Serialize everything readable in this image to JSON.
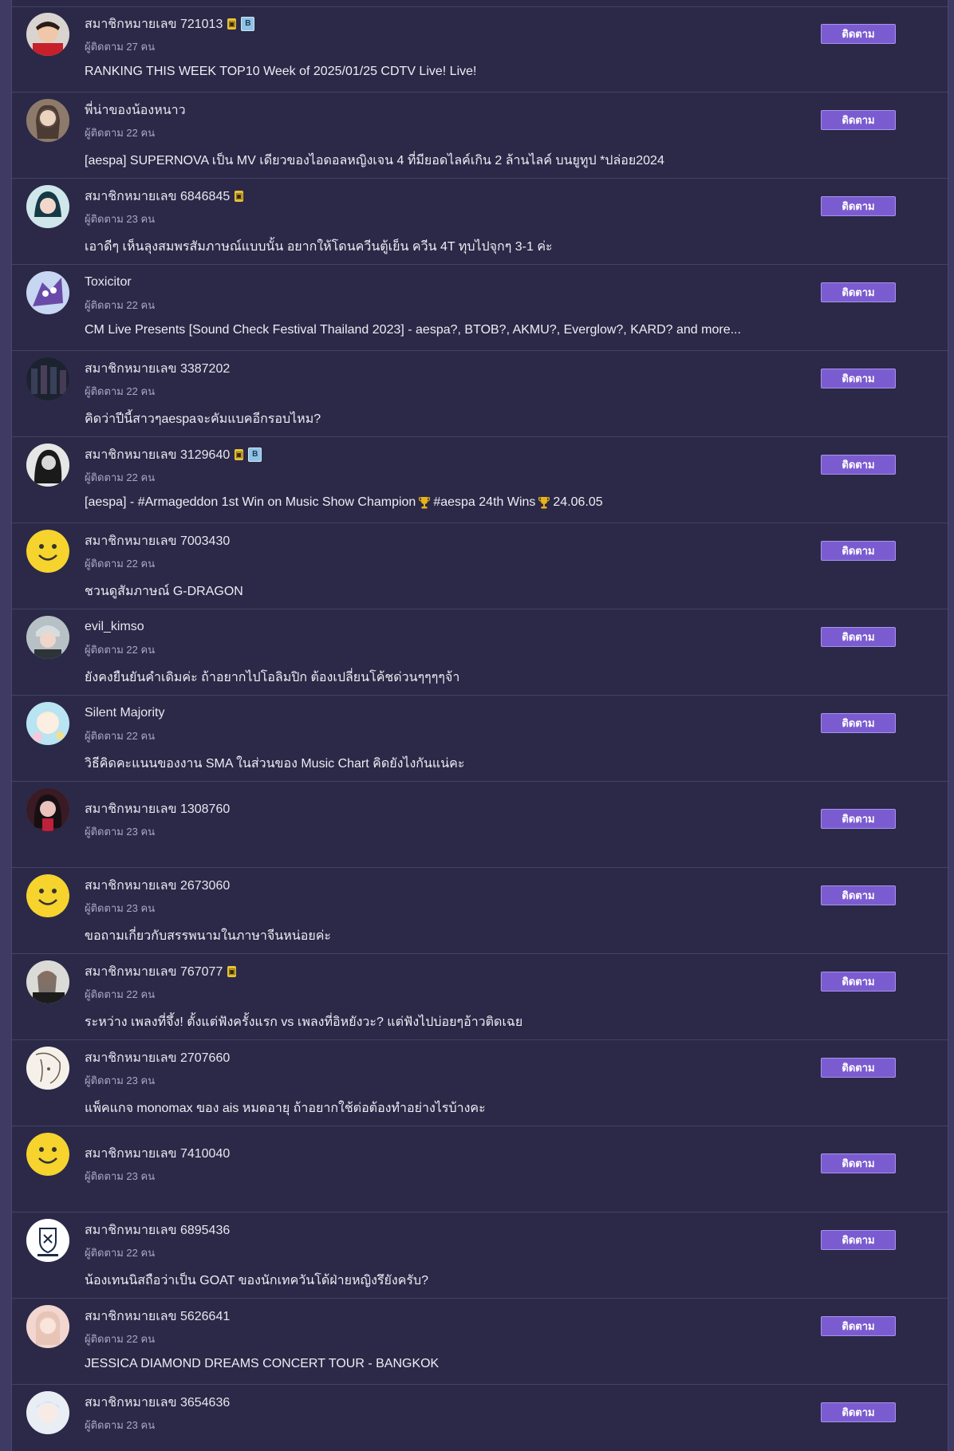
{
  "follow_label": "ติดตาม",
  "colors": {
    "accent": "#7b5cd0",
    "background": "#2b2947",
    "text": "#e6e6f0",
    "muted": "#a9a8c4"
  },
  "rows": [
    {
      "name": "สมาชิกหมายเลข 721013",
      "followers": "ผู้ติดตาม 27 คน",
      "title": "RANKING THIS WEEK TOP10 Week of 2025/01/25 CDTV Live! Live!",
      "badges": [
        "gold",
        "blue"
      ],
      "avatar": "photo-red"
    },
    {
      "name": "พี่น่าของน้องหนาว",
      "followers": "ผู้ติดตาม 22 คน",
      "title": "[aespa] SUPERNOVA เป็น MV เดียวของไอดอลหญิงเจน 4 ที่มียอดไลค์เกิน 2 ล้านไลค์ บนยูทูป *ปล่อย2024",
      "badges": [],
      "avatar": "photo-tan"
    },
    {
      "name": "สมาชิกหมายเลข 6846845",
      "followers": "ผู้ติดตาม 23 คน",
      "title": "เอาดีๆ เห็นลุงสมพรสัมภาษณ์แบบนั้น อยากให้โดนควีนตู้เย็น ควีน 4T ทุบไปจุกๆ 3-1 ค่ะ",
      "badges": [
        "gold"
      ],
      "avatar": "photo-teal"
    },
    {
      "name": "Toxicitor",
      "followers": "ผู้ติดตาม 22 คน",
      "title": "CM Live Presents [Sound Check Festival Thailand 2023] - aespa?, BTOB?, AKMU?, Everglow?, KARD? and more...",
      "badges": [],
      "avatar": "photo-purple"
    },
    {
      "name": "สมาชิกหมายเลข 3387202",
      "followers": "ผู้ติดตาม 22 คน",
      "title": "คิดว่าปีนี้สาวๆaespaจะคัมแบคอีกรอบไหม?",
      "badges": [],
      "avatar": "photo-dark"
    },
    {
      "name": "สมาชิกหมายเลข 3129640",
      "followers": "ผู้ติดตาม 22 คน",
      "title_parts": [
        "[aespa] - #Armageddon 1st Win on Music Show Champion",
        "#aespa 24th Wins",
        "24.06.05"
      ],
      "badges": [
        "gold",
        "blue"
      ],
      "avatar": "photo-bw"
    },
    {
      "name": "สมาชิกหมายเลข 7003430",
      "followers": "ผู้ติดตาม 22 คน",
      "title": "ชวนดูสัมภาษณ์ G-DRAGON",
      "badges": [],
      "avatar": "smiley"
    },
    {
      "name": "evil_kimso",
      "followers": "ผู้ติดตาม 22 คน",
      "title": "ยังคงยืนยันคำเดิมค่ะ ถ้าอยากไปโอลิมปิก ต้องเปลี่ยนโค้ชด่วนๆๆๆๆจ้า",
      "badges": [],
      "avatar": "photo-grey"
    },
    {
      "name": "Silent Majority",
      "followers": "ผู้ติดตาม 22 คน",
      "title": "วิธีคิดคะแนนของงาน SMA ในส่วนของ Music Chart คิดยังไงกันแน่คะ",
      "badges": [],
      "avatar": "photo-anime"
    },
    {
      "name": "สมาชิกหมายเลข 1308760",
      "followers": "ผู้ติดตาม 23 คน",
      "title": "",
      "badges": [],
      "avatar": "photo-crimson"
    },
    {
      "name": "สมาชิกหมายเลข 2673060",
      "followers": "ผู้ติดตาม 23 คน",
      "title": "ขอถามเกี่ยวกับสรรพนามในภาษาจีนหน่อยค่ะ",
      "badges": [],
      "avatar": "smiley"
    },
    {
      "name": "สมาชิกหมายเลข 767077",
      "followers": "ผู้ติดตาม 22 คน",
      "title": "ระหว่าง เพลงที่จึ้ง! ตั้งแต่ฟังครั้งแรก vs เพลงที่อิหยังวะ? แต่ฟังไปบ่อยๆอ้าวติดเฉย",
      "badges": [
        "gold"
      ],
      "avatar": "photo-light"
    },
    {
      "name": "สมาชิกหมายเลข 2707660",
      "followers": "ผู้ติดตาม 23 คน",
      "title": "แพ็คแกจ monomax ของ ais หมดอายุ ถ้าอยากใช้ต่อต้องทำอย่างไรบ้างคะ",
      "badges": [],
      "avatar": "photo-sketch"
    },
    {
      "name": "สมาชิกหมายเลข 7410040",
      "followers": "ผู้ติดตาม 23 คน",
      "title": "",
      "badges": [],
      "avatar": "smiley"
    },
    {
      "name": "สมาชิกหมายเลข 6895436",
      "followers": "ผู้ติดตาม 22 คน",
      "title": "น้องเทนนิสถือว่าเป็น GOAT ของนักเทควันโด้ฝ่ายหญิงรึยังครับ?",
      "badges": [],
      "avatar": "logo-crest"
    },
    {
      "name": "สมาชิกหมายเลข 5626641",
      "followers": "ผู้ติดตาม 22 คน",
      "title": "JESSICA DIAMOND DREAMS CONCERT TOUR - BANGKOK",
      "badges": [],
      "avatar": "photo-pink"
    },
    {
      "name": "สมาชิกหมายเลข 3654636",
      "followers": "ผู้ติดตาม 23 คน",
      "title": "",
      "badges": [],
      "avatar": "photo-pale"
    }
  ]
}
